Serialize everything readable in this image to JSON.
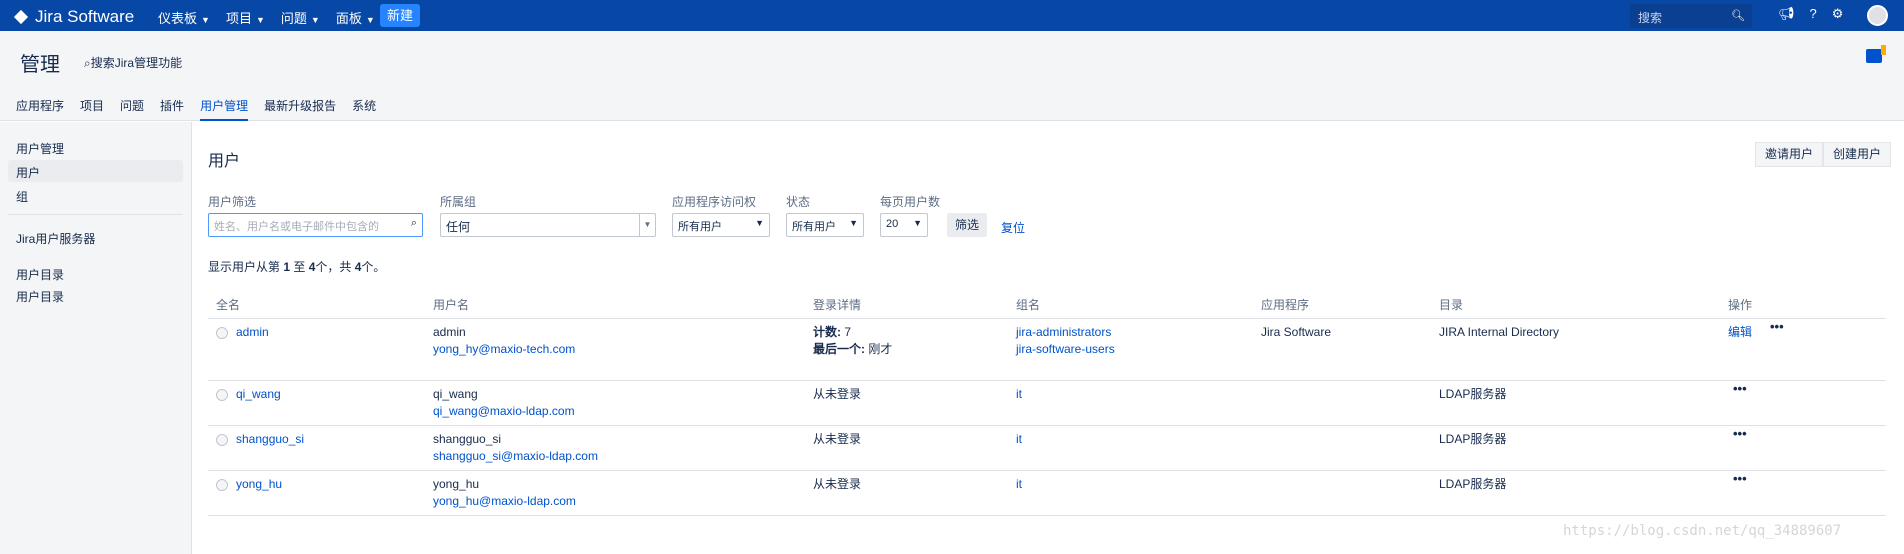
{
  "topnav": {
    "logo": "Jira Software",
    "menu": [
      "仪表板",
      "项目",
      "问题",
      "面板"
    ],
    "create": "新建",
    "search_placeholder": "搜索"
  },
  "admin": {
    "title": "管理",
    "search": "搜索Jira管理功能",
    "tabs": [
      "应用程序",
      "项目",
      "问题",
      "插件",
      "用户管理",
      "最新升级报告",
      "系统"
    ]
  },
  "sidebar": {
    "section1": "用户管理",
    "users": "用户",
    "groups": "组",
    "jira_user_server": "Jira用户服务器",
    "section2": "用户目录",
    "user_directories": "用户目录"
  },
  "main": {
    "title": "用户",
    "invite_btn": "邀请用户",
    "create_btn": "创建用户"
  },
  "filters": {
    "user_filter_label": "用户筛选",
    "user_filter_placeholder": "姓名、用户名或电子邮件中包含的",
    "group_label": "所属组",
    "group_value": "任何",
    "app_access_label": "应用程序访问权",
    "app_access_value": "所有用户",
    "status_label": "状态",
    "status_value": "所有用户",
    "per_page_label": "每页用户数",
    "per_page_value": "20",
    "filter_btn": "筛选",
    "reset": "复位"
  },
  "summary": {
    "prefix": "显示用户从第 ",
    "from": "1",
    "mid1": " 至 ",
    "to": "4",
    "mid2": "个，共 ",
    "total": "4",
    "suffix": "个。"
  },
  "table": {
    "headers": [
      "全名",
      "用户名",
      "登录详情",
      "组名",
      "应用程序",
      "目录",
      "操作"
    ],
    "rows": [
      {
        "fullname": "admin",
        "username": "admin",
        "email": "yong_hy@maxio-tech.com",
        "login_count_label": "计数:",
        "login_count": " 7",
        "login_last_label": "最后一个:",
        "login_last": " 刚才",
        "groups": [
          "jira-administrators",
          "jira-software-users"
        ],
        "application": "Jira Software",
        "directory": "JIRA Internal Directory",
        "edit": "编辑"
      },
      {
        "fullname": "qi_wang",
        "username": "qi_wang",
        "email": "qi_wang@maxio-ldap.com",
        "login": "从未登录",
        "groups": [
          "it"
        ],
        "directory": "LDAP服务器"
      },
      {
        "fullname": "shangguo_si",
        "username": "shangguo_si",
        "email": "shangguo_si@maxio-ldap.com",
        "login": "从未登录",
        "groups": [
          "it"
        ],
        "directory": "LDAP服务器"
      },
      {
        "fullname": "yong_hu",
        "username": "yong_hu",
        "email": "yong_hu@maxio-ldap.com",
        "login": "从未登录",
        "groups": [
          "it"
        ],
        "directory": "LDAP服务器"
      }
    ],
    "more_glyph": "•••"
  },
  "watermark": "https://blog.csdn.net/qq_34889607"
}
